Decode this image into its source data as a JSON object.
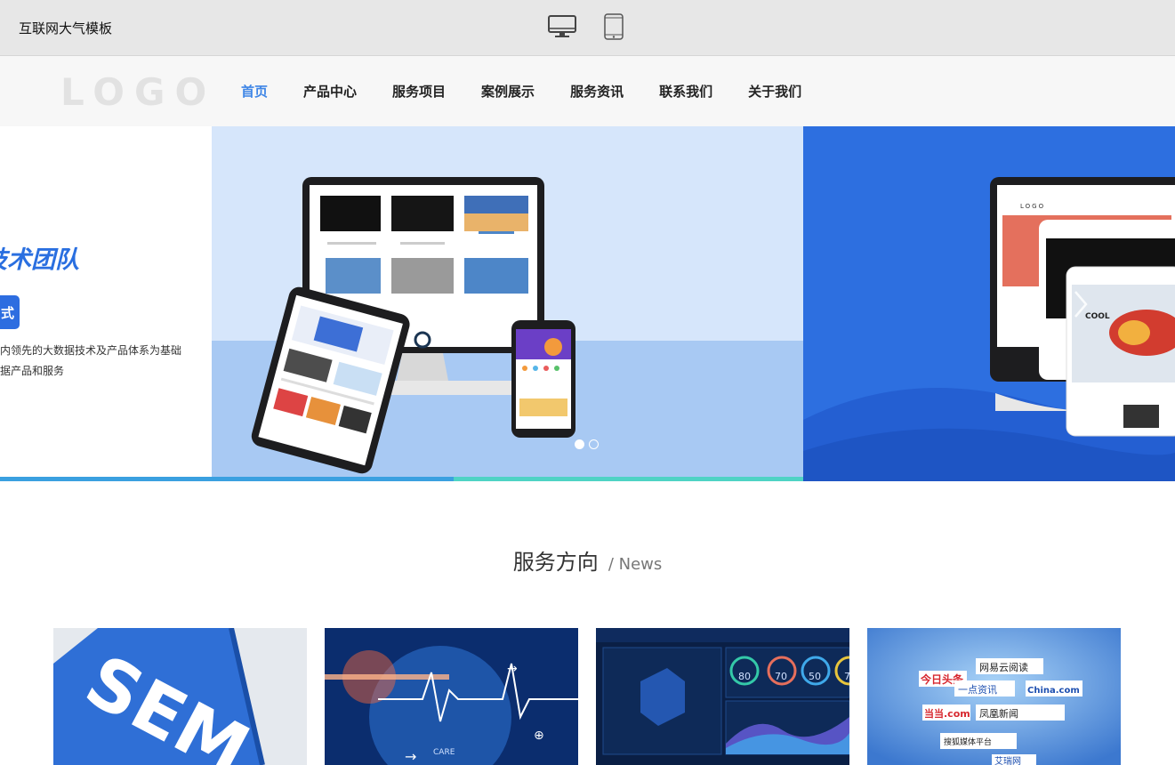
{
  "topbar": {
    "site_title": "互联网大气模板",
    "devices": [
      "desktop-icon",
      "tablet-icon"
    ]
  },
  "header": {
    "logo": "LOGO",
    "nav": [
      {
        "label": "首页",
        "active": true
      },
      {
        "label": "产品中心",
        "active": false
      },
      {
        "label": "服务项目",
        "active": false
      },
      {
        "label": "案例展示",
        "active": false
      },
      {
        "label": "服务资讯",
        "active": false
      },
      {
        "label": "联系我们",
        "active": false
      },
      {
        "label": "关于我们",
        "active": false
      }
    ]
  },
  "banner": {
    "left_slide": {
      "headline": "业技术团队",
      "pill": "式",
      "line1": "内领先的大数据技术及产品体系为基础",
      "line2": "据产品和服务"
    },
    "right_slide": {
      "logo_text": "LOGO",
      "cool_text": "COOL"
    },
    "active_dot": 0,
    "dot_count": 2
  },
  "section": {
    "title": "服务方向",
    "subtitle": "/ News"
  },
  "cards": [
    {
      "image": "sem-keyboard-image",
      "text": "SEM"
    },
    {
      "image": "medical-tech-image",
      "text": "CARE"
    },
    {
      "image": "data-dashboard-image",
      "gauges": [
        "80",
        "70",
        "50",
        "7"
      ]
    },
    {
      "image": "media-logos-image",
      "logos": [
        "今日头条",
        "网易云阅读",
        "一点资讯",
        "China.com",
        "当当.com",
        "凤凰新闻",
        "搜狐媒体平台",
        "艾瑞网"
      ]
    }
  ],
  "colors": {
    "accent": "#3f86e6",
    "banner_blue": "#2d6fe0",
    "progress_a": "#3aa0e0",
    "progress_b": "#4fd3c4"
  }
}
